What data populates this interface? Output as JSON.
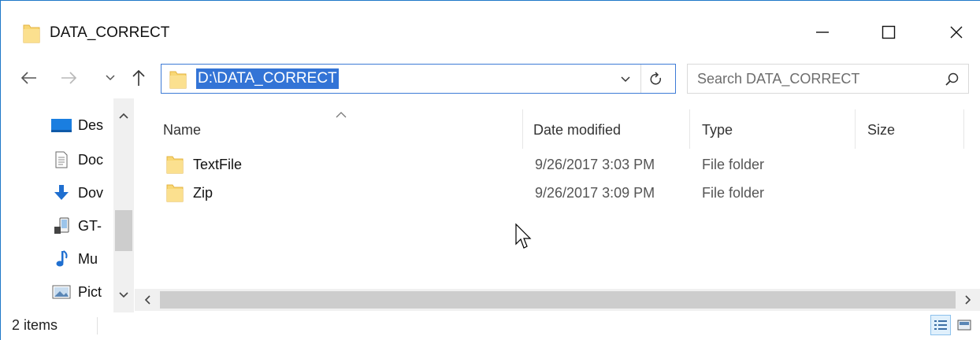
{
  "window": {
    "title": "DATA_CORRECT",
    "accent_color": "#1e78c8",
    "selection_color": "#3374d6"
  },
  "address_bar": {
    "path": "D:\\DATA_CORRECT"
  },
  "search": {
    "placeholder": "Search DATA_CORRECT"
  },
  "sidebar": {
    "items": [
      {
        "label": "Des",
        "icon": "desktop-icon"
      },
      {
        "label": "Doc",
        "icon": "documents-icon"
      },
      {
        "label": "Dov",
        "icon": "downloads-icon"
      },
      {
        "label": "GT-",
        "icon": "device-icon"
      },
      {
        "label": "Mu",
        "icon": "music-icon"
      },
      {
        "label": "Pict",
        "icon": "pictures-icon"
      }
    ]
  },
  "columns": {
    "name": "Name",
    "date": "Date modified",
    "type": "Type",
    "size": "Size"
  },
  "files": [
    {
      "name": "TextFile",
      "date": "9/26/2017 3:03 PM",
      "type": "File folder",
      "icon": "folder-icon"
    },
    {
      "name": "Zip",
      "date": "9/26/2017 3:09 PM",
      "type": "File folder",
      "icon": "folder-icon"
    }
  ],
  "status": {
    "item_count": "2 items"
  }
}
